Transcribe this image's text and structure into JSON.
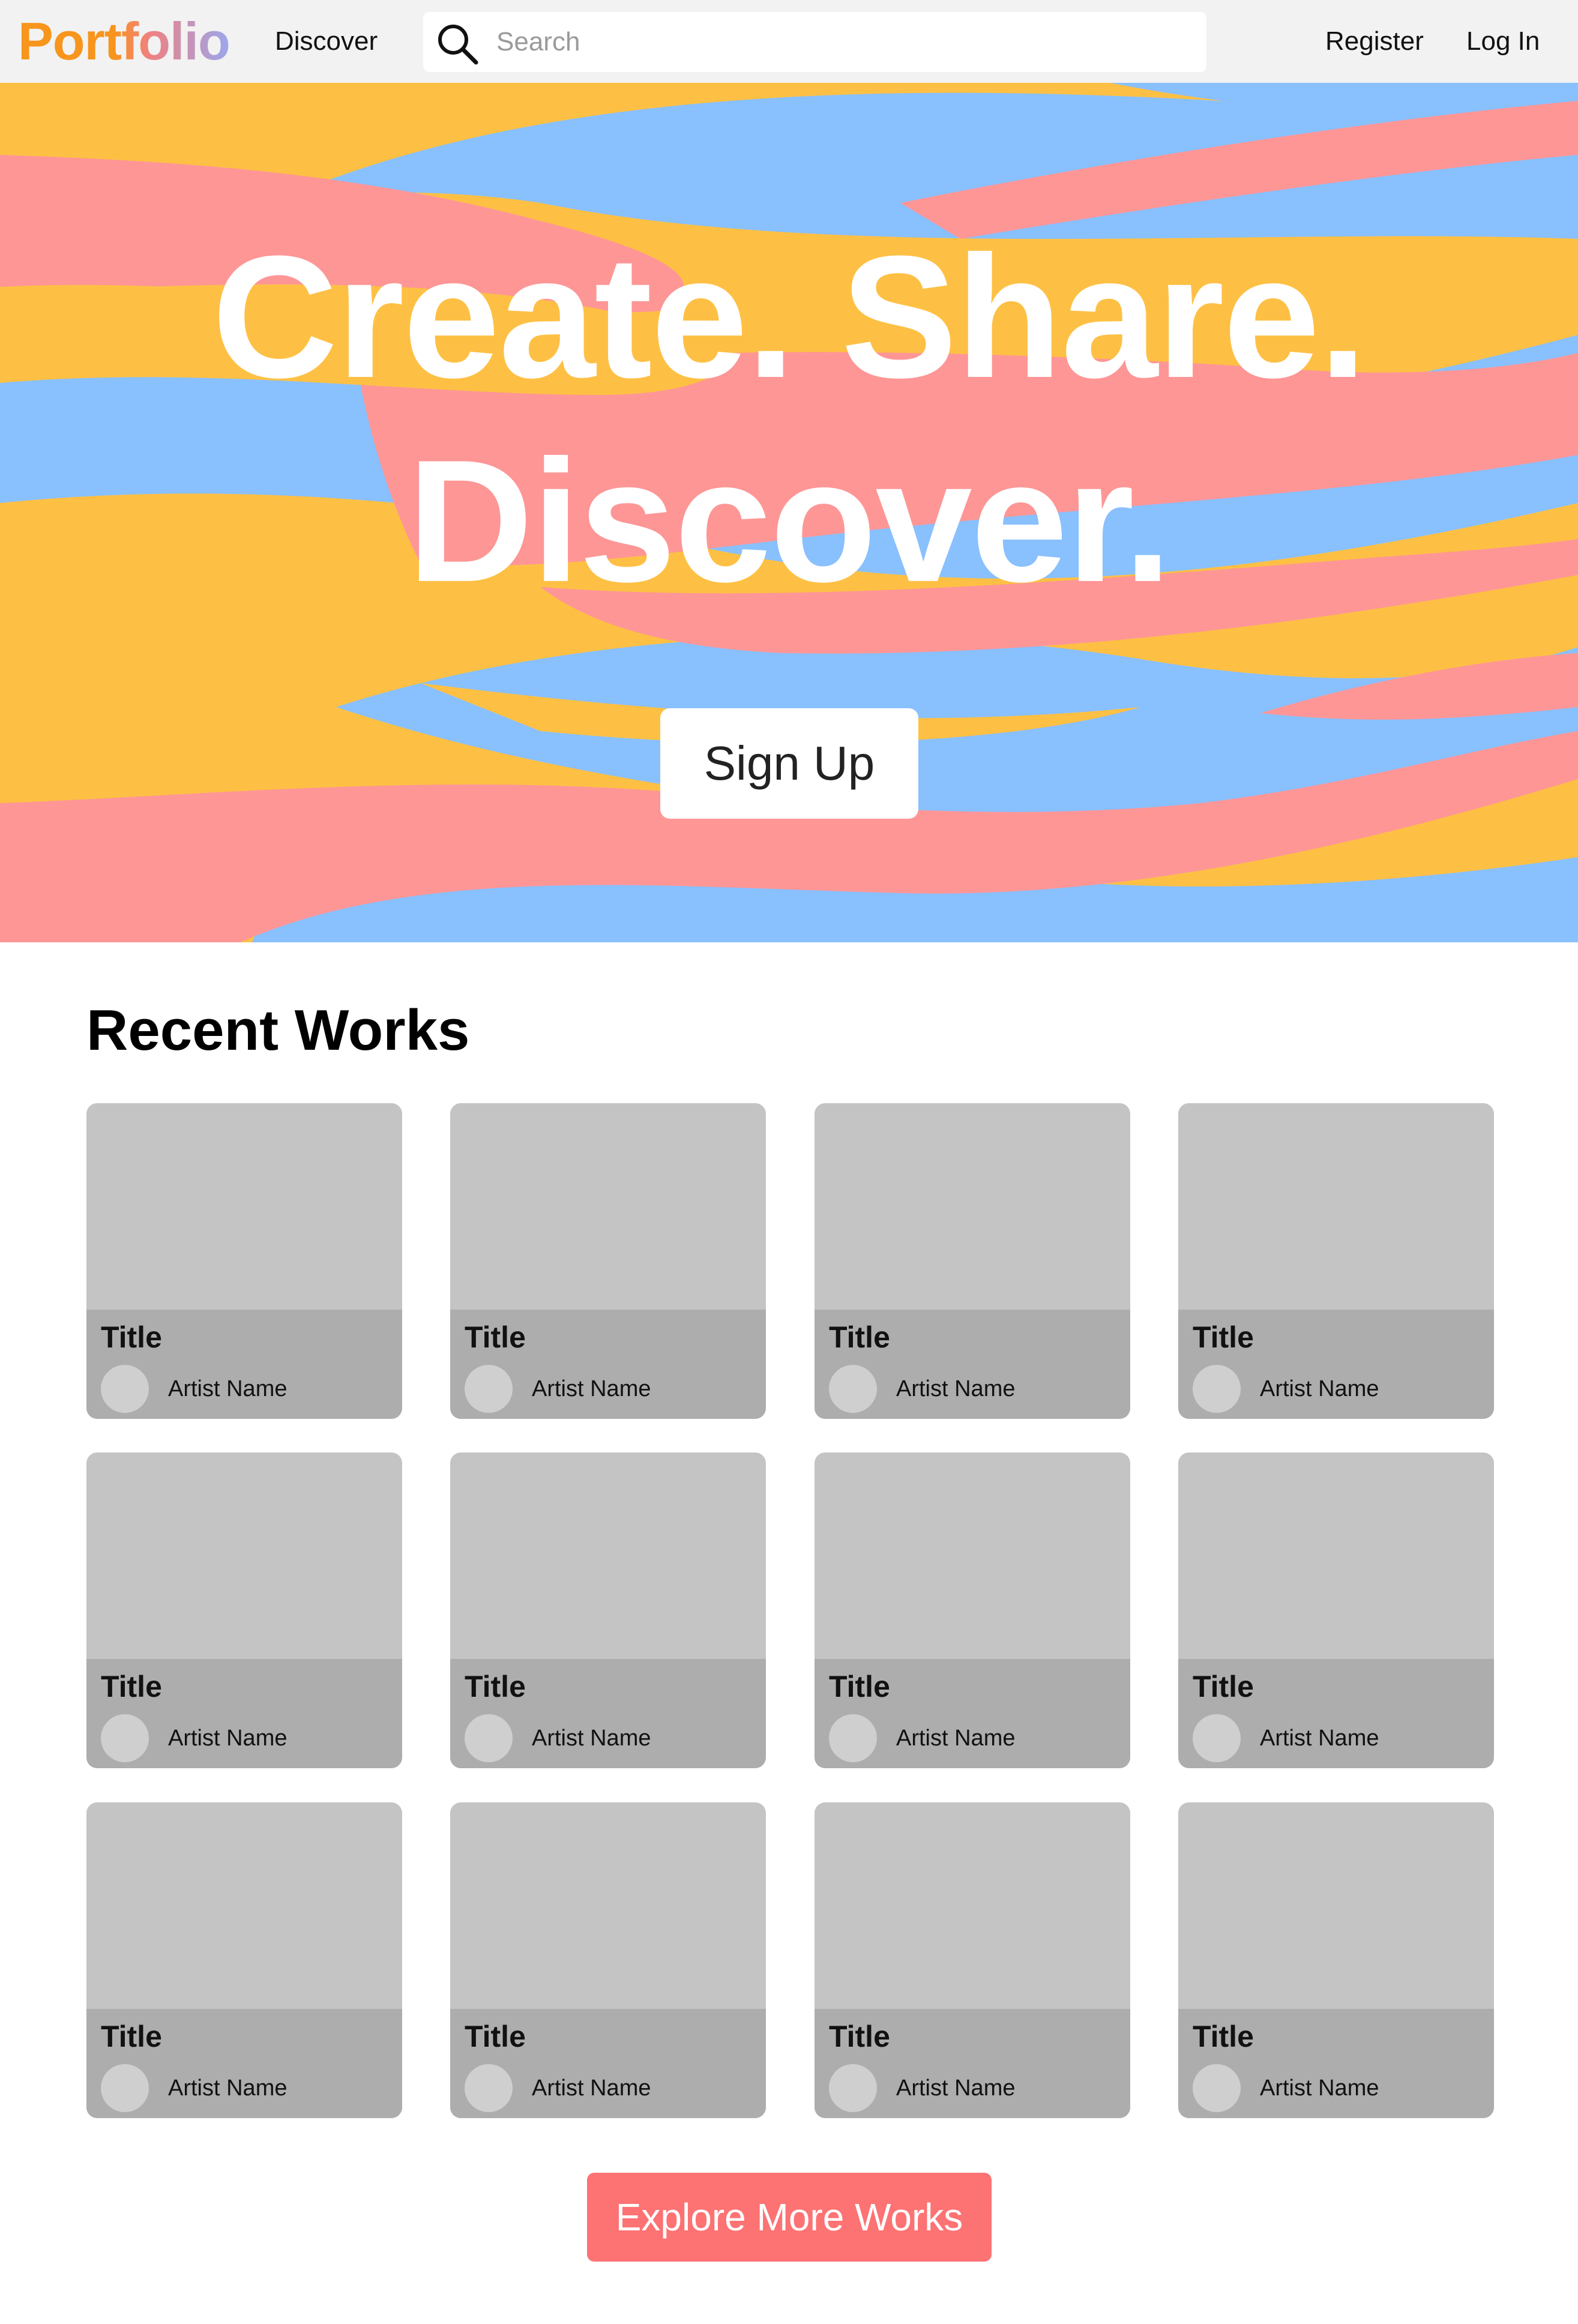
{
  "header": {
    "logo": "Portfolio",
    "discover_label": "Discover",
    "search_placeholder": "Search",
    "search_value": "",
    "register_label": "Register",
    "login_label": "Log In",
    "search_icon": "search-icon"
  },
  "hero": {
    "line1": "Create. Share.",
    "line2": "Discover.",
    "signup_label": "Sign Up",
    "colors": {
      "yellow": "#fec044",
      "blue": "#89c0fe",
      "pink": "#fe9696"
    }
  },
  "recent": {
    "title": "Recent Works",
    "cards": [
      {
        "title": "Title",
        "artist": "Artist Name"
      },
      {
        "title": "Title",
        "artist": "Artist Name"
      },
      {
        "title": "Title",
        "artist": "Artist Name"
      },
      {
        "title": "Title",
        "artist": "Artist Name"
      },
      {
        "title": "Title",
        "artist": "Artist Name"
      },
      {
        "title": "Title",
        "artist": "Artist Name"
      },
      {
        "title": "Title",
        "artist": "Artist Name"
      },
      {
        "title": "Title",
        "artist": "Artist Name"
      },
      {
        "title": "Title",
        "artist": "Artist Name"
      },
      {
        "title": "Title",
        "artist": "Artist Name"
      },
      {
        "title": "Title",
        "artist": "Artist Name"
      },
      {
        "title": "Title",
        "artist": "Artist Name"
      }
    ]
  },
  "explore_label": "Explore More Works",
  "colors": {
    "accent": "#fd7273",
    "card_thumb": "#c4c4c4",
    "card_info": "#adadad",
    "nav_bg": "#f2f2f2"
  }
}
